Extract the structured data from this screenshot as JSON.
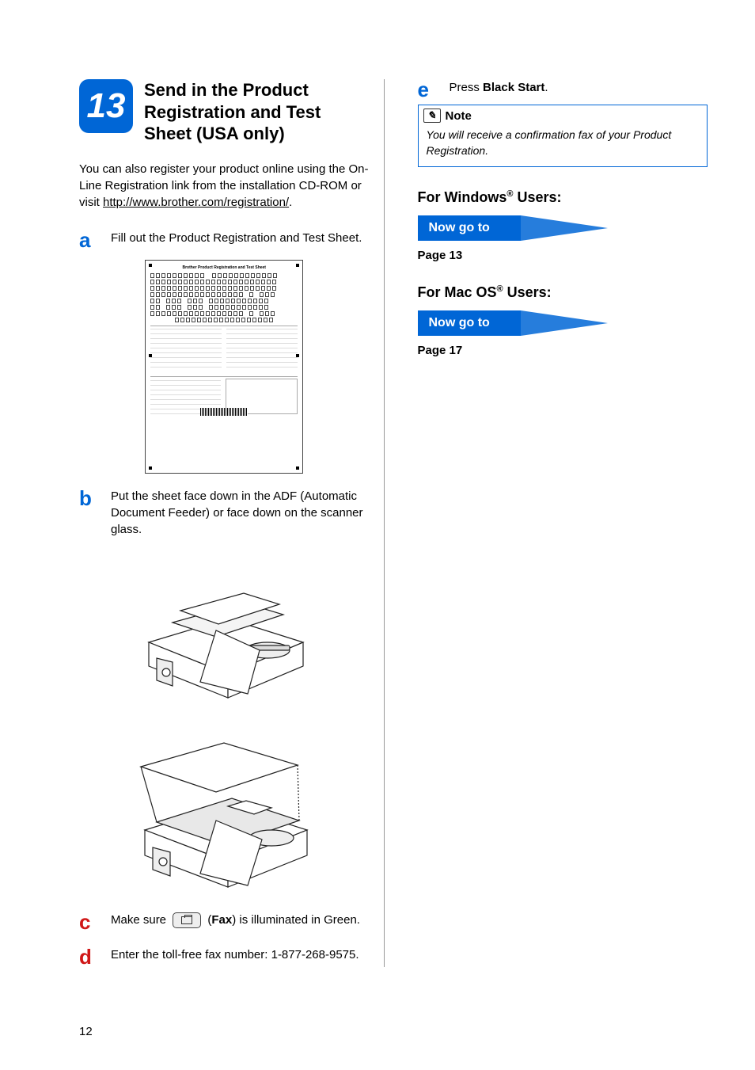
{
  "step": {
    "number": "13",
    "title": "Send in the Product Registration and Test Sheet (USA only)"
  },
  "intro_text": "You can also register your product online using the On-Line Registration link from the installation CD-ROM or visit ",
  "intro_link": "http://www.brother.com/registration/",
  "intro_suffix": ".",
  "steps": {
    "a": "Fill out the Product Registration and Test Sheet.",
    "b": "Put the sheet face down in the ADF (Automatic Document Feeder) or face down on the scanner glass.",
    "c_pre": "Make sure ",
    "c_mid": " (",
    "c_bold": "Fax",
    "c_post": ") is illuminated in Green.",
    "d": "Enter the toll-free fax number: 1-877-268-9575.",
    "e_pre": "Press ",
    "e_bold": "Black Start",
    "e_post": "."
  },
  "note": {
    "label": "Note",
    "body": "You will receive a confirmation fax of your Product Registration."
  },
  "windows": {
    "heading_pre": "For Windows",
    "heading_post": " Users:",
    "goto": "Now go to",
    "page": "Page 13"
  },
  "macos": {
    "heading_pre": "For Mac OS",
    "heading_post": " Users:",
    "goto": "Now go to",
    "page": "Page 17"
  },
  "reg_sheet_title": "Brother Product Registration and Test Sheet",
  "page_number": "12"
}
